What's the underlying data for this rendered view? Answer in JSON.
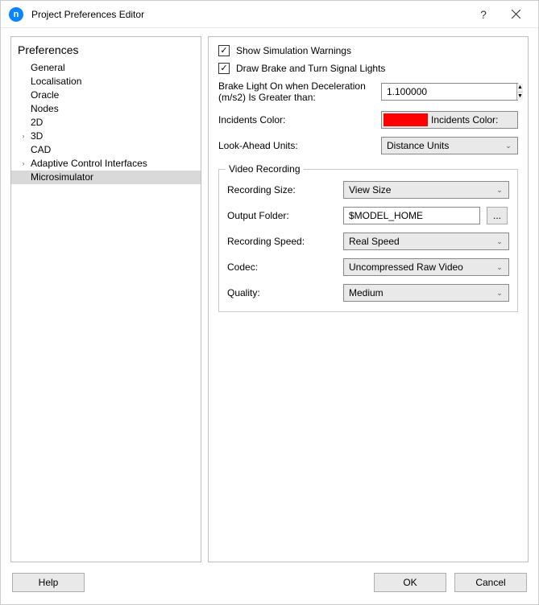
{
  "window": {
    "title": "Project Preferences Editor"
  },
  "sidebar": {
    "header": "Preferences",
    "items": [
      {
        "label": "General",
        "expandable": false,
        "selected": false
      },
      {
        "label": "Localisation",
        "expandable": false,
        "selected": false
      },
      {
        "label": "Oracle",
        "expandable": false,
        "selected": false
      },
      {
        "label": "Nodes",
        "expandable": false,
        "selected": false
      },
      {
        "label": "2D",
        "expandable": false,
        "selected": false
      },
      {
        "label": "3D",
        "expandable": true,
        "selected": false
      },
      {
        "label": "CAD",
        "expandable": false,
        "selected": false
      },
      {
        "label": "Adaptive Control Interfaces",
        "expandable": true,
        "selected": false
      },
      {
        "label": "Microsimulator",
        "expandable": false,
        "selected": true
      }
    ]
  },
  "main": {
    "show_warnings": {
      "label": "Show Simulation Warnings",
      "checked": true
    },
    "draw_lights": {
      "label": "Draw Brake and Turn Signal Lights",
      "checked": true
    },
    "brake_light": {
      "label": "Brake Light On when Deceleration (m/s2) Is Greater than:",
      "value": "1.100000"
    },
    "incidents_color": {
      "label": "Incidents Color:",
      "button_text": "Incidents Color:",
      "color": "#ff0000"
    },
    "look_ahead": {
      "label": "Look-Ahead Units:",
      "value": "Distance Units"
    },
    "video": {
      "group_title": "Video Recording",
      "recording_size": {
        "label": "Recording Size:",
        "value": "View Size"
      },
      "output_folder": {
        "label": "Output Folder:",
        "value": "$MODEL_HOME"
      },
      "recording_speed": {
        "label": "Recording Speed:",
        "value": "Real Speed"
      },
      "codec": {
        "label": "Codec:",
        "value": "Uncompressed Raw Video"
      },
      "quality": {
        "label": "Quality:",
        "value": "Medium"
      },
      "browse_label": "..."
    }
  },
  "buttons": {
    "help": "Help",
    "ok": "OK",
    "cancel": "Cancel"
  }
}
